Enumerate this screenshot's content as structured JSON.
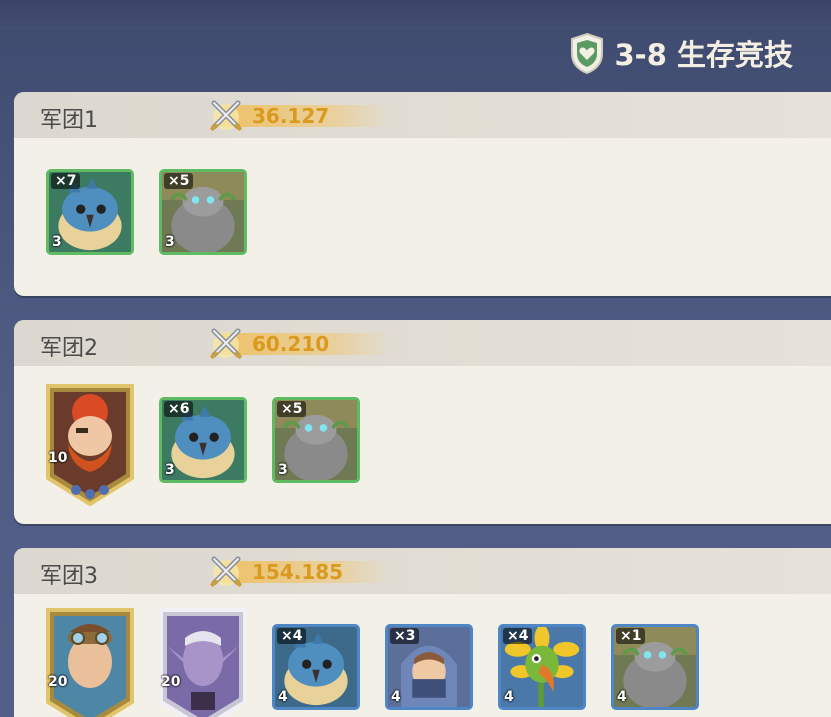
{
  "stage": {
    "label": "3-8 生存竞技",
    "icon": "heart-shield-icon"
  },
  "legions": [
    {
      "title": "军团1",
      "power": "36.127",
      "heroes": [],
      "units": [
        {
          "name": "blue-bird",
          "count": "×7",
          "level": "3",
          "rarity": "green"
        },
        {
          "name": "rock-golem",
          "count": "×5",
          "level": "3",
          "rarity": "green"
        }
      ]
    },
    {
      "title": "军团2",
      "power": "60.210",
      "heroes": [
        {
          "name": "red-bearded-dwarf",
          "level": "10",
          "frame": "gold"
        }
      ],
      "units": [
        {
          "name": "blue-bird",
          "count": "×6",
          "level": "3",
          "rarity": "green"
        },
        {
          "name": "rock-golem",
          "count": "×5",
          "level": "3",
          "rarity": "green"
        }
      ]
    },
    {
      "title": "军团3",
      "power": "154.185",
      "heroes": [
        {
          "name": "goggles-adventurer",
          "level": "20",
          "frame": "gold"
        },
        {
          "name": "purple-elf",
          "level": "20",
          "frame": "silver"
        }
      ],
      "units": [
        {
          "name": "blue-bird",
          "count": "×4",
          "level": "4",
          "rarity": "blue"
        },
        {
          "name": "hooded-rogue",
          "count": "×3",
          "level": "4",
          "rarity": "blue"
        },
        {
          "name": "flower-parrot",
          "count": "×4",
          "level": "4",
          "rarity": "blue"
        },
        {
          "name": "rock-golem",
          "count": "×1",
          "level": "4",
          "rarity": "blue"
        }
      ]
    }
  ],
  "colors": {
    "background": "#4f5b82",
    "panel": "#f3f0e8",
    "power_text": "#d99a1e",
    "green_frame": "#5fbb62",
    "blue_frame": "#4f86c6"
  }
}
